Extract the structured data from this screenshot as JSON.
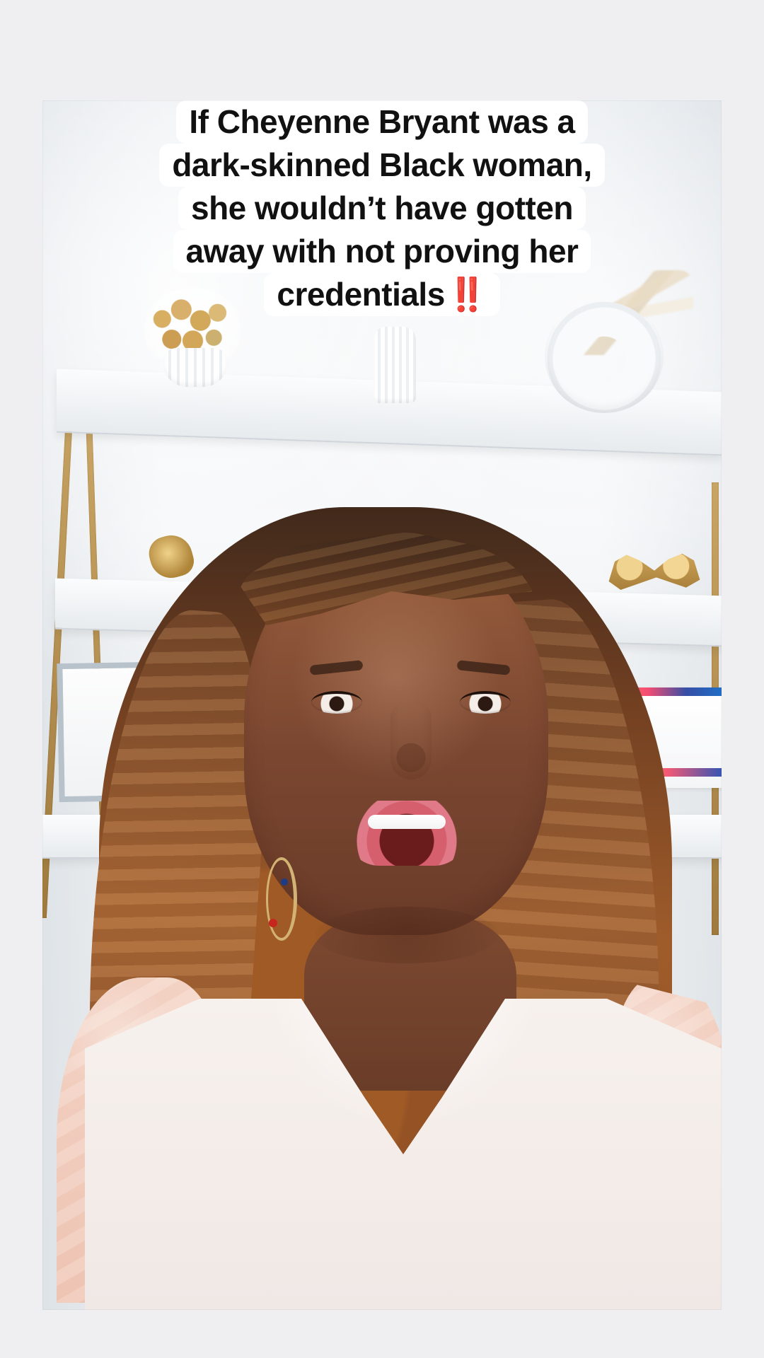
{
  "caption": {
    "lines": [
      "If Cheyenne Bryant was a",
      "dark-skinned  Black woman,",
      "she wouldn’t have gotten",
      "away with not proving her",
      "credentials"
    ],
    "alert_marks": "‼️"
  },
  "colors": {
    "page_background": "#efeff2",
    "caption_background": "#ffffff",
    "caption_text": "#111111",
    "alert_red": "#e11e22"
  }
}
